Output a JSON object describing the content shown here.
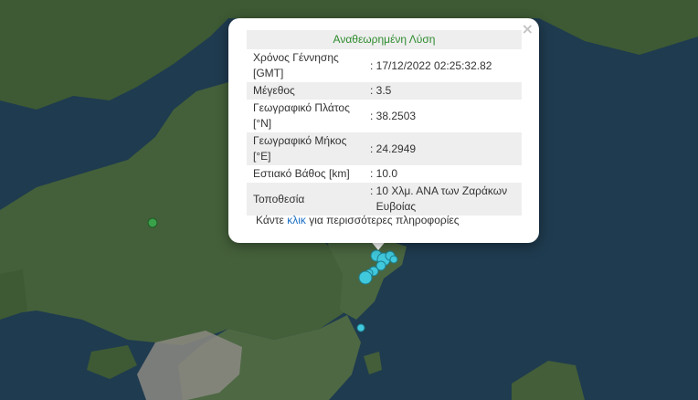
{
  "popup": {
    "title": "Αναθεωρημένη Λύση",
    "close_symbol": "×",
    "rows": [
      {
        "key_line1": "Χρόνος Γέννησης",
        "key_line2": "[GMT]",
        "value": ": 17/12/2022 02:25:32.82"
      },
      {
        "key_line1": "Μέγεθος",
        "key_line2": "",
        "value": ": 3.5"
      },
      {
        "key_line1": "Γεωγραφικό Πλάτος",
        "key_line2": "[°N]",
        "value": ": 38.2503"
      },
      {
        "key_line1": "Γεωγραφικό Μήκος",
        "key_line2": "[°E]",
        "value": ": 24.2949"
      },
      {
        "key_line1": "Εστιακό Βάθος [km]",
        "key_line2": "",
        "value": ": 10.0"
      },
      {
        "key_line1": "Τοποθεσία",
        "key_line2": "",
        "value": ": 10 Χλμ. ΑΝΑ των Ζαράκων",
        "value_line2": "Ευβοίας"
      }
    ],
    "more_prefix": "Κάντε ",
    "more_link": "κλικ",
    "more_suffix": " για περισσότερες πληροφορίες"
  },
  "map": {
    "colors": {
      "sea": "#1f3b4f",
      "land": "#3f5a33",
      "land_dark": "#2f4a2a",
      "urban": "#8c8a83",
      "marker_cyan": "#40c8dc",
      "marker_green": "#3aa14a"
    },
    "markers": [
      {
        "color": "cyan",
        "role": "earthquake"
      },
      {
        "color": "green",
        "role": "earthquake"
      }
    ]
  }
}
